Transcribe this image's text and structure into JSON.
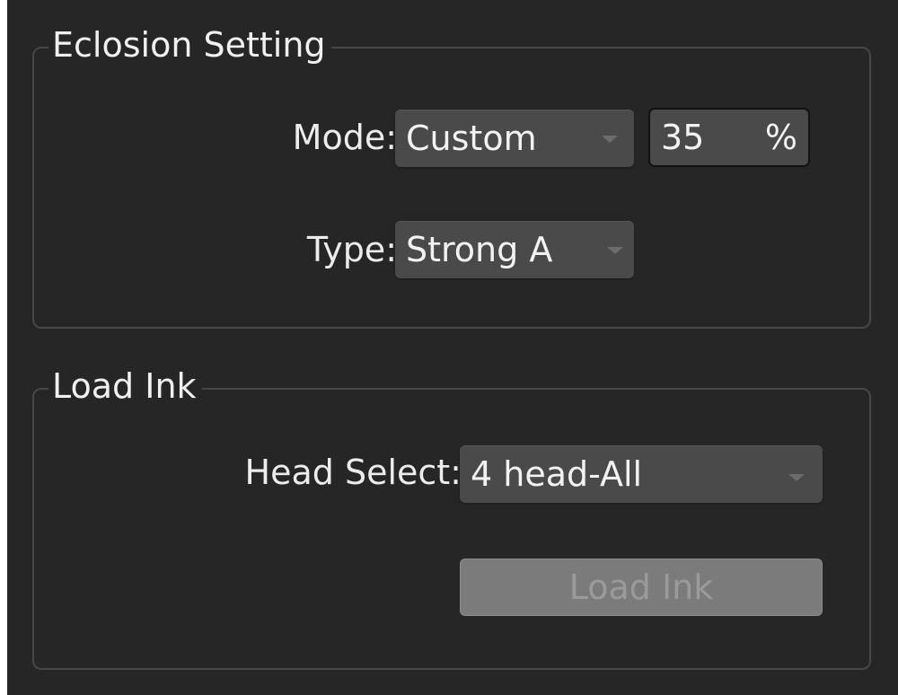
{
  "eclosion": {
    "title": "Eclosion Setting",
    "mode_label": "Mode:",
    "mode_value": "Custom",
    "percent_value": "35",
    "percent_unit": "%",
    "type_label": "Type:",
    "type_value": "Strong A"
  },
  "load_ink": {
    "title": "Load Ink",
    "head_select_label": "Head Select:",
    "head_select_value": "4 head-All",
    "button_label": "Load Ink"
  }
}
